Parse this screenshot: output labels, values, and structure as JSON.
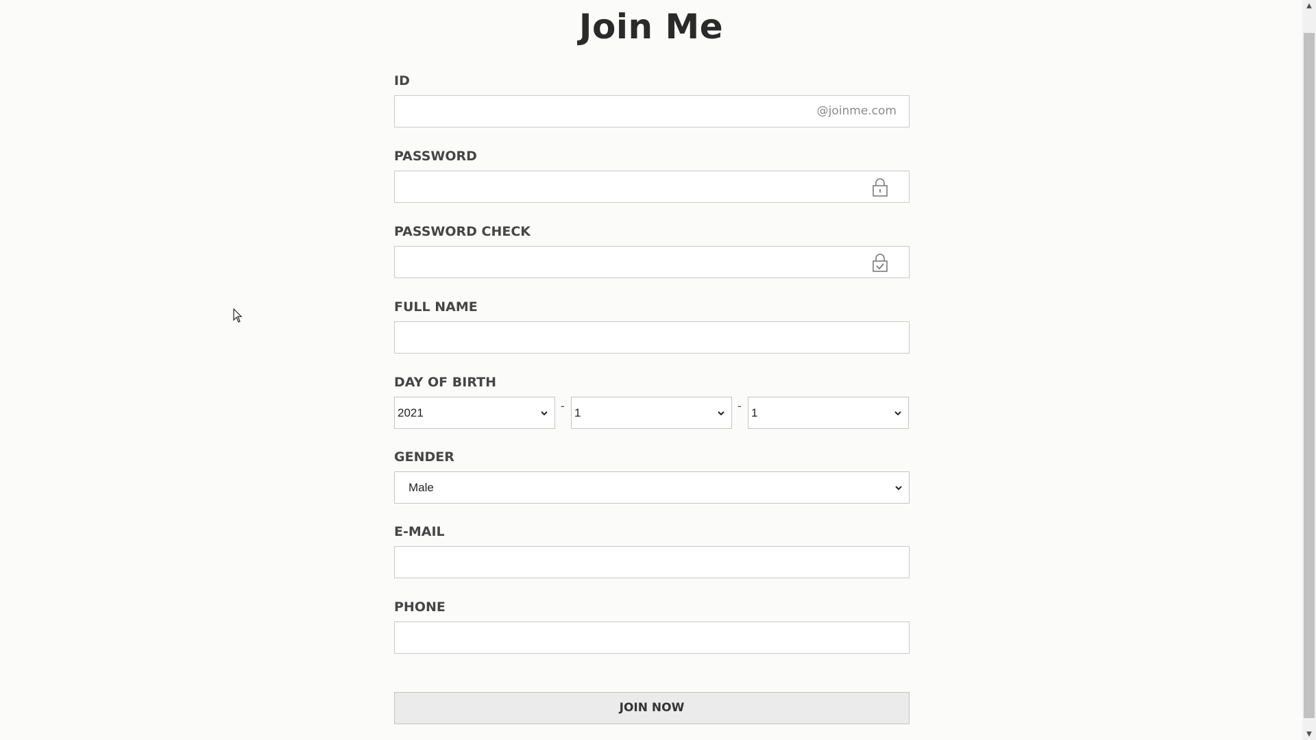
{
  "page": {
    "title": "Join Me"
  },
  "form": {
    "id": {
      "label": "ID",
      "value": "",
      "suffix": "@joinme.com"
    },
    "password": {
      "label": "PASSWORD",
      "value": "",
      "icon": "lock-icon"
    },
    "password_check": {
      "label": "PASSWORD CHECK",
      "value": "",
      "icon": "lock-check-icon"
    },
    "full_name": {
      "label": "FULL NAME",
      "value": ""
    },
    "birth": {
      "label": "DAY OF BIRTH",
      "year": "2021",
      "month": "1",
      "day": "1",
      "separator": "-"
    },
    "gender": {
      "label": "GENDER",
      "value": "Male"
    },
    "email": {
      "label": "E-MAIL",
      "value": ""
    },
    "phone": {
      "label": "PHONE",
      "value": ""
    },
    "submit_label": "JOIN NOW"
  },
  "scrollbar": {
    "up_arrow": "▲",
    "down_arrow": "▼"
  },
  "colors": {
    "background": "#fbfbfa",
    "input_border": "#c9c9c9",
    "button_background": "#ebebeb"
  }
}
